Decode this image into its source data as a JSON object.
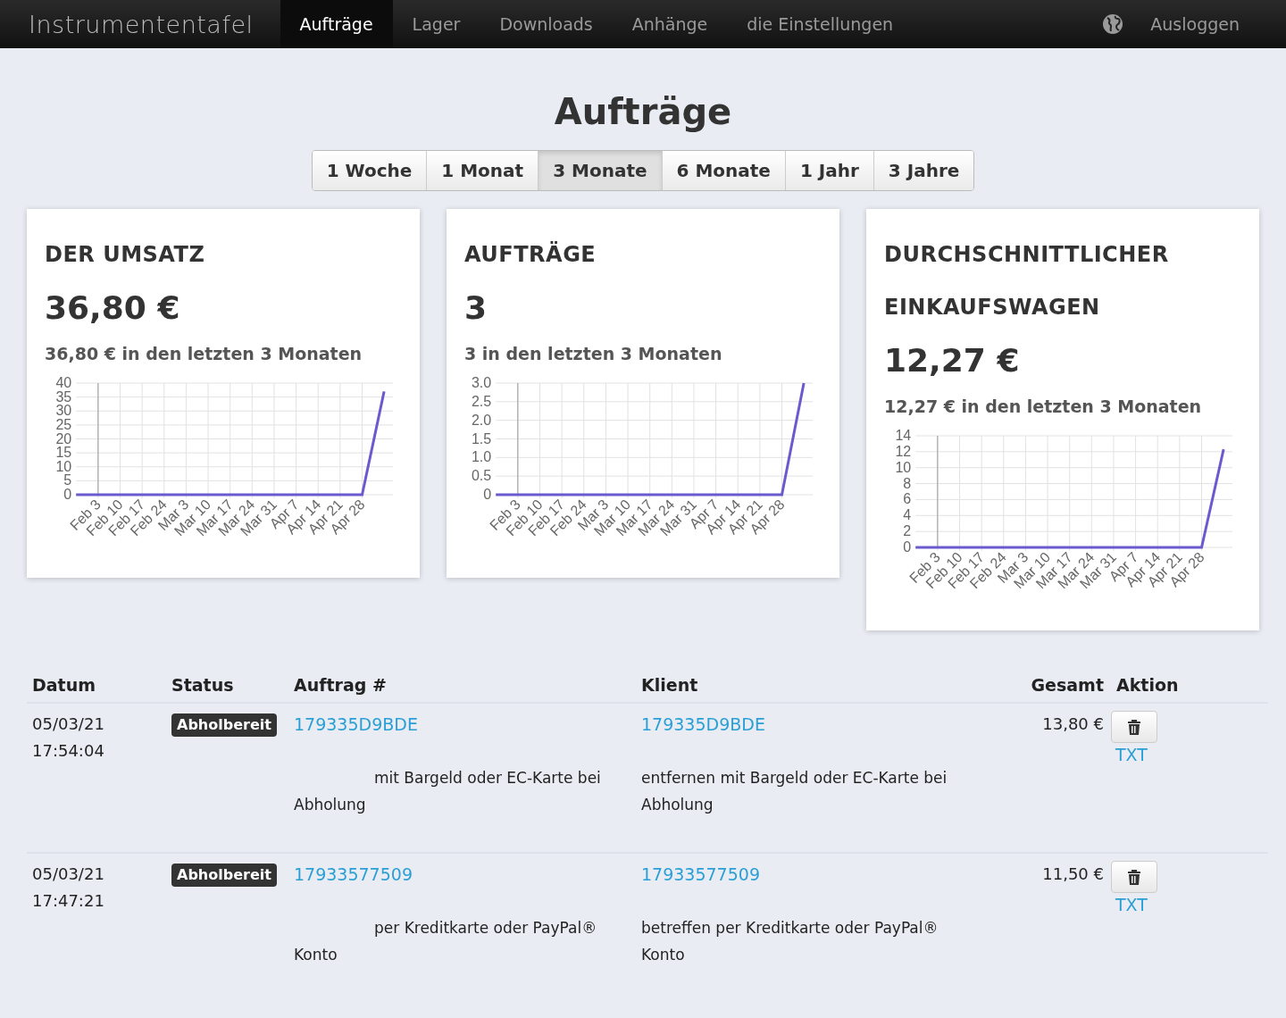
{
  "nav": {
    "brand": "Instrumententafel",
    "items": [
      {
        "label": "Aufträge",
        "selected": true
      },
      {
        "label": "Lager",
        "selected": false
      },
      {
        "label": "Downloads",
        "selected": false
      },
      {
        "label": "Anhänge",
        "selected": false
      },
      {
        "label": "die Einstellungen",
        "selected": false
      }
    ],
    "logout": "Ausloggen"
  },
  "title": "Aufträge",
  "ranges": [
    {
      "label": "1 Woche",
      "selected": false
    },
    {
      "label": "1 Monat",
      "selected": false
    },
    {
      "label": "3 Monate",
      "selected": true
    },
    {
      "label": "6 Monate",
      "selected": false
    },
    {
      "label": "1 Jahr",
      "selected": false
    },
    {
      "label": "3 Jahre",
      "selected": false
    }
  ],
  "cards": [
    {
      "title": "DER UMSATZ",
      "value": "36,80 €",
      "subtitle": "36,80 € in den letzten 3 Monaten",
      "chart_data": {
        "type": "line",
        "categories": [
          null,
          "Feb 3",
          "Feb 10",
          "Feb 17",
          "Feb 24",
          "Mar 3",
          "Mar 10",
          "Mar 17",
          "Mar 24",
          "Mar 31",
          "Apr 7",
          "Apr 14",
          "Apr 21",
          "Apr 28",
          null
        ],
        "series": [
          {
            "color": "#6a5acd",
            "values": [
              0,
              0,
              0,
              0,
              0,
              0,
              0,
              0,
              0,
              0,
              0,
              0,
              0,
              0,
              37
            ]
          }
        ],
        "ylim": [
          0,
          40
        ],
        "grid": true,
        "yticks": [
          0,
          5,
          10,
          15,
          20,
          25,
          30,
          35,
          40
        ]
      }
    },
    {
      "title": "AUFTRÄGE",
      "value": "3",
      "subtitle": "3 in den letzten 3 Monaten",
      "chart_data": {
        "type": "line",
        "categories": [
          null,
          "Feb 3",
          "Feb 10",
          "Feb 17",
          "Feb 24",
          "Mar 3",
          "Mar 10",
          "Mar 17",
          "Mar 24",
          "Mar 31",
          "Apr 7",
          "Apr 14",
          "Apr 21",
          "Apr 28",
          null
        ],
        "series": [
          {
            "color": "#6a5acd",
            "values": [
              0,
              0,
              0,
              0,
              0,
              0,
              0,
              0,
              0,
              0,
              0,
              0,
              0,
              0,
              3
            ]
          }
        ],
        "ylim": [
          0,
          3
        ],
        "grid": true,
        "yticks": [
          0,
          {
            "value": 0.5,
            "label": "0.5"
          },
          {
            "value": 1,
            "label": "1.0"
          },
          {
            "value": 1.5,
            "label": "1.5"
          },
          {
            "value": 2,
            "label": "2.0"
          },
          {
            "value": 2.5,
            "label": "2.5"
          },
          {
            "value": 3,
            "label": "3.0"
          }
        ]
      }
    },
    {
      "title": "DURCHSCHNITTLICHER EINKAUFSWAGEN",
      "value": "12,27 €",
      "subtitle": "12,27 € in den letzten 3 Monaten",
      "chart_data": {
        "type": "line",
        "categories": [
          null,
          "Feb 3",
          "Feb 10",
          "Feb 17",
          "Feb 24",
          "Mar 3",
          "Mar 10",
          "Mar 17",
          "Mar 24",
          "Mar 31",
          "Apr 7",
          "Apr 14",
          "Apr 21",
          "Apr 28",
          null
        ],
        "series": [
          {
            "color": "#6a5acd",
            "values": [
              0,
              0,
              0,
              0,
              0,
              0,
              0,
              0,
              0,
              0,
              0,
              0,
              0,
              0,
              12.3
            ]
          }
        ],
        "ylim": [
          0,
          14
        ],
        "grid": true,
        "yticks": [
          0,
          2,
          4,
          6,
          8,
          10,
          12,
          14
        ]
      }
    }
  ],
  "table": {
    "columns": [
      "Datum",
      "Status",
      "Auftrag #",
      "Klient",
      "Gesamt",
      "Aktion"
    ],
    "rows": [
      {
        "date": "05/03/21",
        "time": "17:54:04",
        "status": "Abholbereit",
        "order": "179335D9BDE",
        "order_note": "mit Bargeld oder EC-Karte bei Abholung",
        "client": "179335D9BDE",
        "client_note": "entfernen mit Bargeld oder EC-Karte bei Abholung",
        "total": "13,80 €",
        "link": "TXT"
      },
      {
        "date": "05/03/21",
        "time": "17:47:21",
        "status": "Abholbereit",
        "order": "17933577509",
        "order_note": "per Kreditkarte oder PayPal® Konto",
        "client": "17933577509",
        "client_note": "betreffen per Kreditkarte oder PayPal® Konto",
        "total": "11,50 €",
        "link": "TXT"
      }
    ]
  }
}
